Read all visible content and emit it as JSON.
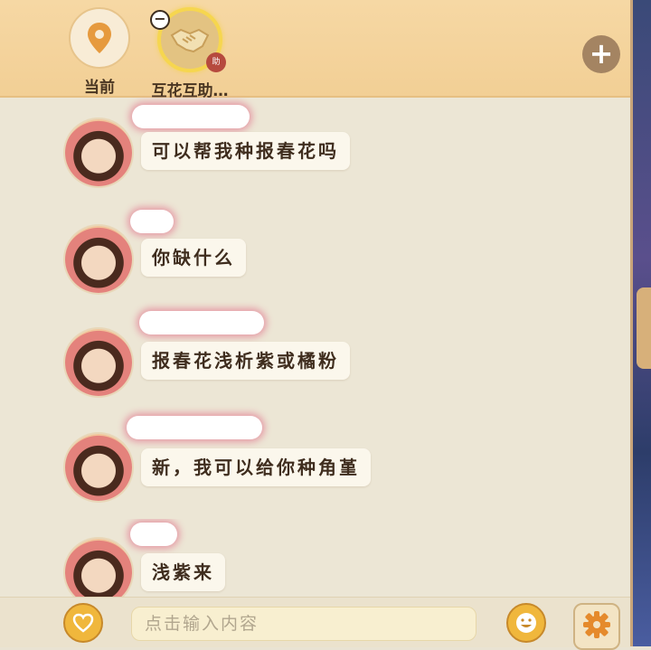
{
  "header": {
    "tabs": [
      {
        "label": "当前",
        "icon": "location-pin-icon",
        "active": false
      },
      {
        "label": "互花互助…",
        "icon": "handshake-icon",
        "active": true,
        "badge": "助"
      }
    ],
    "add_icon": "plus-icon",
    "remove_icon": "minus-icon"
  },
  "messages": [
    {
      "text": "可以帮我种报春花吗"
    },
    {
      "text": "你缺什么"
    },
    {
      "text": "报春花浅析紫或橘粉"
    },
    {
      "text": "新，我可以给你种角堇"
    },
    {
      "text": "浅紫来"
    }
  ],
  "composer": {
    "placeholder": "点击输入内容",
    "left_icon": "heart-hand-icon",
    "emoji_icon": "smiley-icon",
    "settings_icon": "gear-icon"
  },
  "colors": {
    "panel_bg": "#ece6d5",
    "header_bg": "#f4d39b",
    "accent": "#f0b73c",
    "text": "#3f2d1e"
  }
}
